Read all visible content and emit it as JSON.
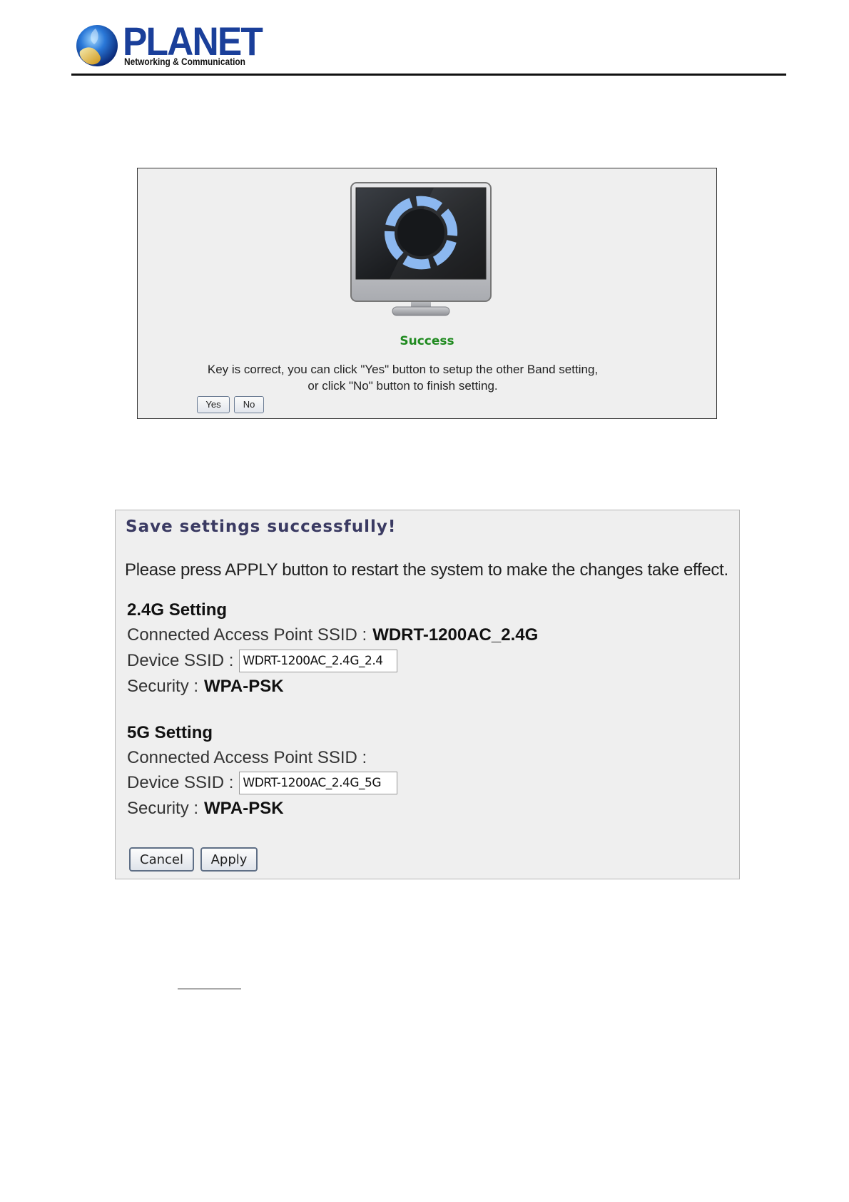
{
  "header": {
    "brand_name": "PLANET",
    "tagline": "Networking & Communication"
  },
  "success_dialog": {
    "title": "Success",
    "message_line1": "Key is correct, you can click \"Yes\" button to setup the other Band setting,",
    "message_line2": "or click \"No\" button to finish setting.",
    "yes_label": "Yes",
    "no_label": "No",
    "icon": "monitor-icon"
  },
  "save_dialog": {
    "title": "Save settings successfully!",
    "instruction": "Please press APPLY button to restart the system to make the changes take effect.",
    "band_24g": {
      "heading": "2.4G Setting",
      "connected_label": "Connected Access Point SSID :",
      "connected_value": "WDRT-1200AC_2.4G",
      "device_ssid_label": "Device SSID :",
      "device_ssid_value": "WDRT-1200AC_2.4G_2.4",
      "security_label": "Security :",
      "security_value": "WPA-PSK"
    },
    "band_5g": {
      "heading": "5G Setting",
      "connected_label": "Connected Access Point SSID :",
      "connected_value": "",
      "device_ssid_label": "Device SSID :",
      "device_ssid_value": "WDRT-1200AC_2.4G_5G",
      "security_label": "Security :",
      "security_value": "WPA-PSK"
    },
    "cancel_label": "Cancel",
    "apply_label": "Apply"
  },
  "colors": {
    "brand_blue": "#1a3f9a",
    "success_green": "#1f8a1f",
    "panel_bg": "#efefef",
    "title_navy": "#3a3a62"
  }
}
